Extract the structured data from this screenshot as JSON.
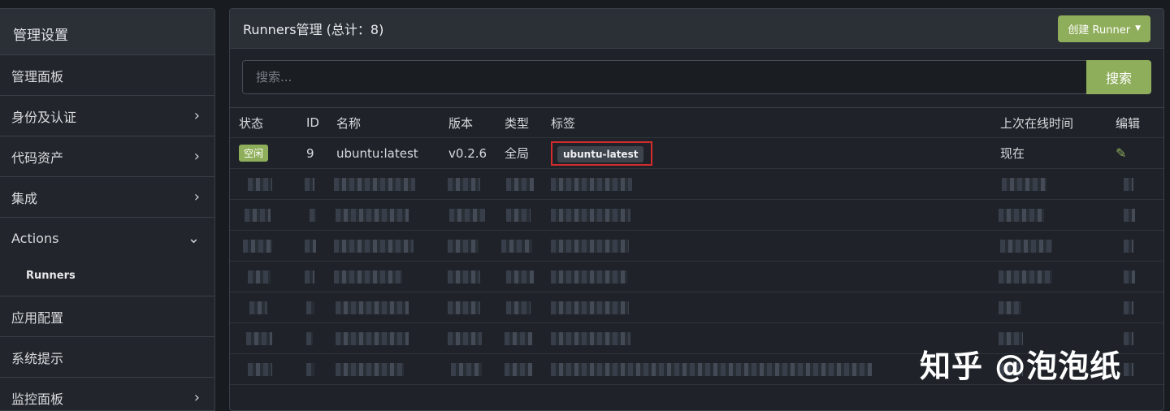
{
  "sidebar": {
    "title": "管理设置",
    "items": [
      {
        "label": "管理面板",
        "chevron": ""
      },
      {
        "label": "身份及认证",
        "chevron": "›"
      },
      {
        "label": "代码资产",
        "chevron": "›"
      },
      {
        "label": "集成",
        "chevron": "›"
      },
      {
        "label": "Actions",
        "chevron": "⌄"
      },
      {
        "label": "应用配置",
        "chevron": ""
      },
      {
        "label": "系统提示",
        "chevron": ""
      },
      {
        "label": "监控面板",
        "chevron": "›"
      }
    ],
    "sub_item": "Runners"
  },
  "panel": {
    "title": "Runners管理 (总计：8)",
    "create_button": "创建 Runner",
    "caret": "▼"
  },
  "search": {
    "placeholder": "搜索...",
    "value": "",
    "button": "搜索"
  },
  "table": {
    "headers": {
      "status": "状态",
      "id": "ID",
      "name": "名称",
      "version": "版本",
      "type": "类型",
      "labels": "标签",
      "last_online": "上次在线时间",
      "edit": "编辑"
    },
    "rows": [
      {
        "status": "空闲",
        "id": "9",
        "name": "ubuntu:latest",
        "version": "v0.2.6",
        "type": "全局",
        "label": "ubuntu-latest",
        "last_online": "现在",
        "edit_icon": "pencil-icon"
      }
    ]
  },
  "edit_glyph": "✎",
  "watermark": "知乎 @泡泡纸",
  "colors": {
    "accent": "#8fae5b",
    "highlight": "#d22c2c"
  }
}
